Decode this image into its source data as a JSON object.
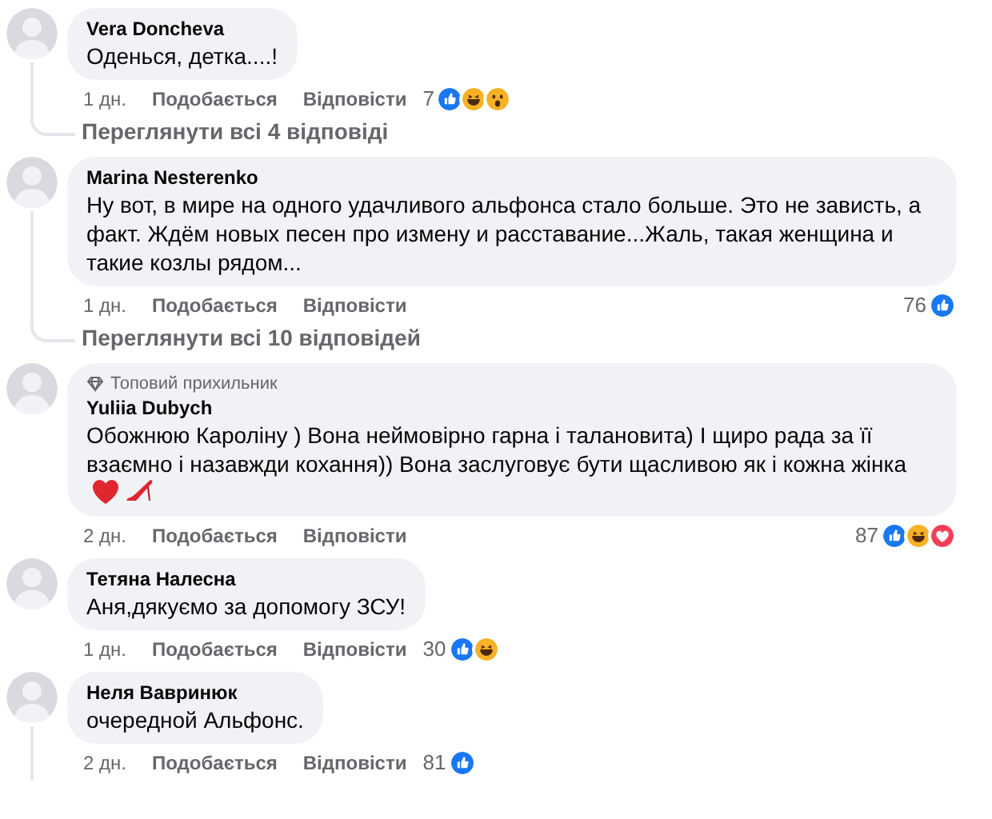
{
  "comments": [
    {
      "author": "Vera Doncheva",
      "text": "Оденься, детка....!",
      "time": "1 дн.",
      "like": "Подобається",
      "reply": "Відповісти",
      "count": "7",
      "reactions": [
        {
          "kind": "like"
        },
        {
          "kind": "haha"
        },
        {
          "kind": "wow"
        }
      ],
      "view_replies": "Переглянути всі 4 відповіді"
    },
    {
      "author": "Marina Nesterenko",
      "text": "Ну вот, в мире на одного удачливого альфонса стало больше. Это не зависть, а факт. Ждём новых песен про измену и расставание...Жаль, такая женщина и такие козлы рядом...",
      "time": "1 дн.",
      "like": "Подобається",
      "reply": "Відповісти",
      "count": "76",
      "reactions": [
        {
          "kind": "like"
        }
      ],
      "view_replies": "Переглянути всі 10 відповідей"
    },
    {
      "badge": "Топовий прихильник",
      "author": "Yuliia Dubych",
      "text": "Обожнюю Кароліну ) Вона неймовірно гарна і талановита) І щиро рада за її взаємно і назавжди кохання)) Вона заслуговує бути щасливою як і кожна жінка",
      "emoji": [
        {
          "kind": "heart"
        },
        {
          "kind": "high-heel"
        }
      ],
      "time": "2 дн.",
      "like": "Подобається",
      "reply": "Відповісти",
      "count": "87",
      "reactions": [
        {
          "kind": "like"
        },
        {
          "kind": "haha"
        },
        {
          "kind": "love"
        }
      ]
    },
    {
      "author": "Тетяна Налесна",
      "text": "Аня,дякуємо за допомогу ЗСУ!",
      "time": "1 дн.",
      "like": "Подобається",
      "reply": "Відповісти",
      "count": "30",
      "reactions": [
        {
          "kind": "like"
        },
        {
          "kind": "haha"
        }
      ]
    },
    {
      "author": "Неля Вавринюк",
      "text": "очередной Альфонс.",
      "time": "2 дн.",
      "like": "Подобається",
      "reply": "Відповісти",
      "count": "81",
      "reactions": [
        {
          "kind": "like"
        }
      ],
      "thread": true
    }
  ]
}
